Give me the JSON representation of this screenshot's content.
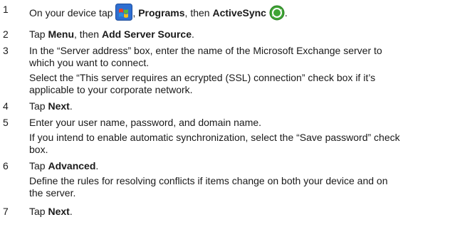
{
  "steps": [
    {
      "num": "1",
      "a": "On your device tap ",
      "b1": "Programs",
      "c": ", then ",
      "b2": "ActiveSync",
      "d": "."
    },
    {
      "num": "2",
      "a": "Tap ",
      "b1": "Menu",
      "c": ", then ",
      "b2": "Add Server Source",
      "d": "."
    },
    {
      "num": "3",
      "l1": "In the “Server address” box, enter the name of the Microsoft Exchange server to",
      "l2": "which you want to connect."
    },
    {
      "num": "4",
      "a": "Tap ",
      "b1": "Next",
      "d": "."
    },
    {
      "num": "5",
      "text": "Enter your user name, password, and domain name."
    },
    {
      "num": "6",
      "a": "Tap ",
      "b1": "Advanced",
      "d": "."
    },
    {
      "num": "7",
      "a": "Tap ",
      "b1": "Next",
      "d": "."
    }
  ],
  "notes": {
    "ssl_l1": "Select the “This server requires an ecrypted (SSL) connection” check box if it’s",
    "ssl_l2": "applicable to your corporate network.",
    "pwd_l1": "If you intend to enable automatic synchronization, select the “Save password” check",
    "pwd_l2": "box.",
    "rules_l1": "Define the rules for resolving conflicts if items change on both your device and on",
    "rules_l2": "the server."
  },
  "icons": {
    "start": "windows-start-icon",
    "activesync": "activesync-icon",
    "start_bg": "#2f6fd1",
    "activesync_color": "#3fa535"
  }
}
